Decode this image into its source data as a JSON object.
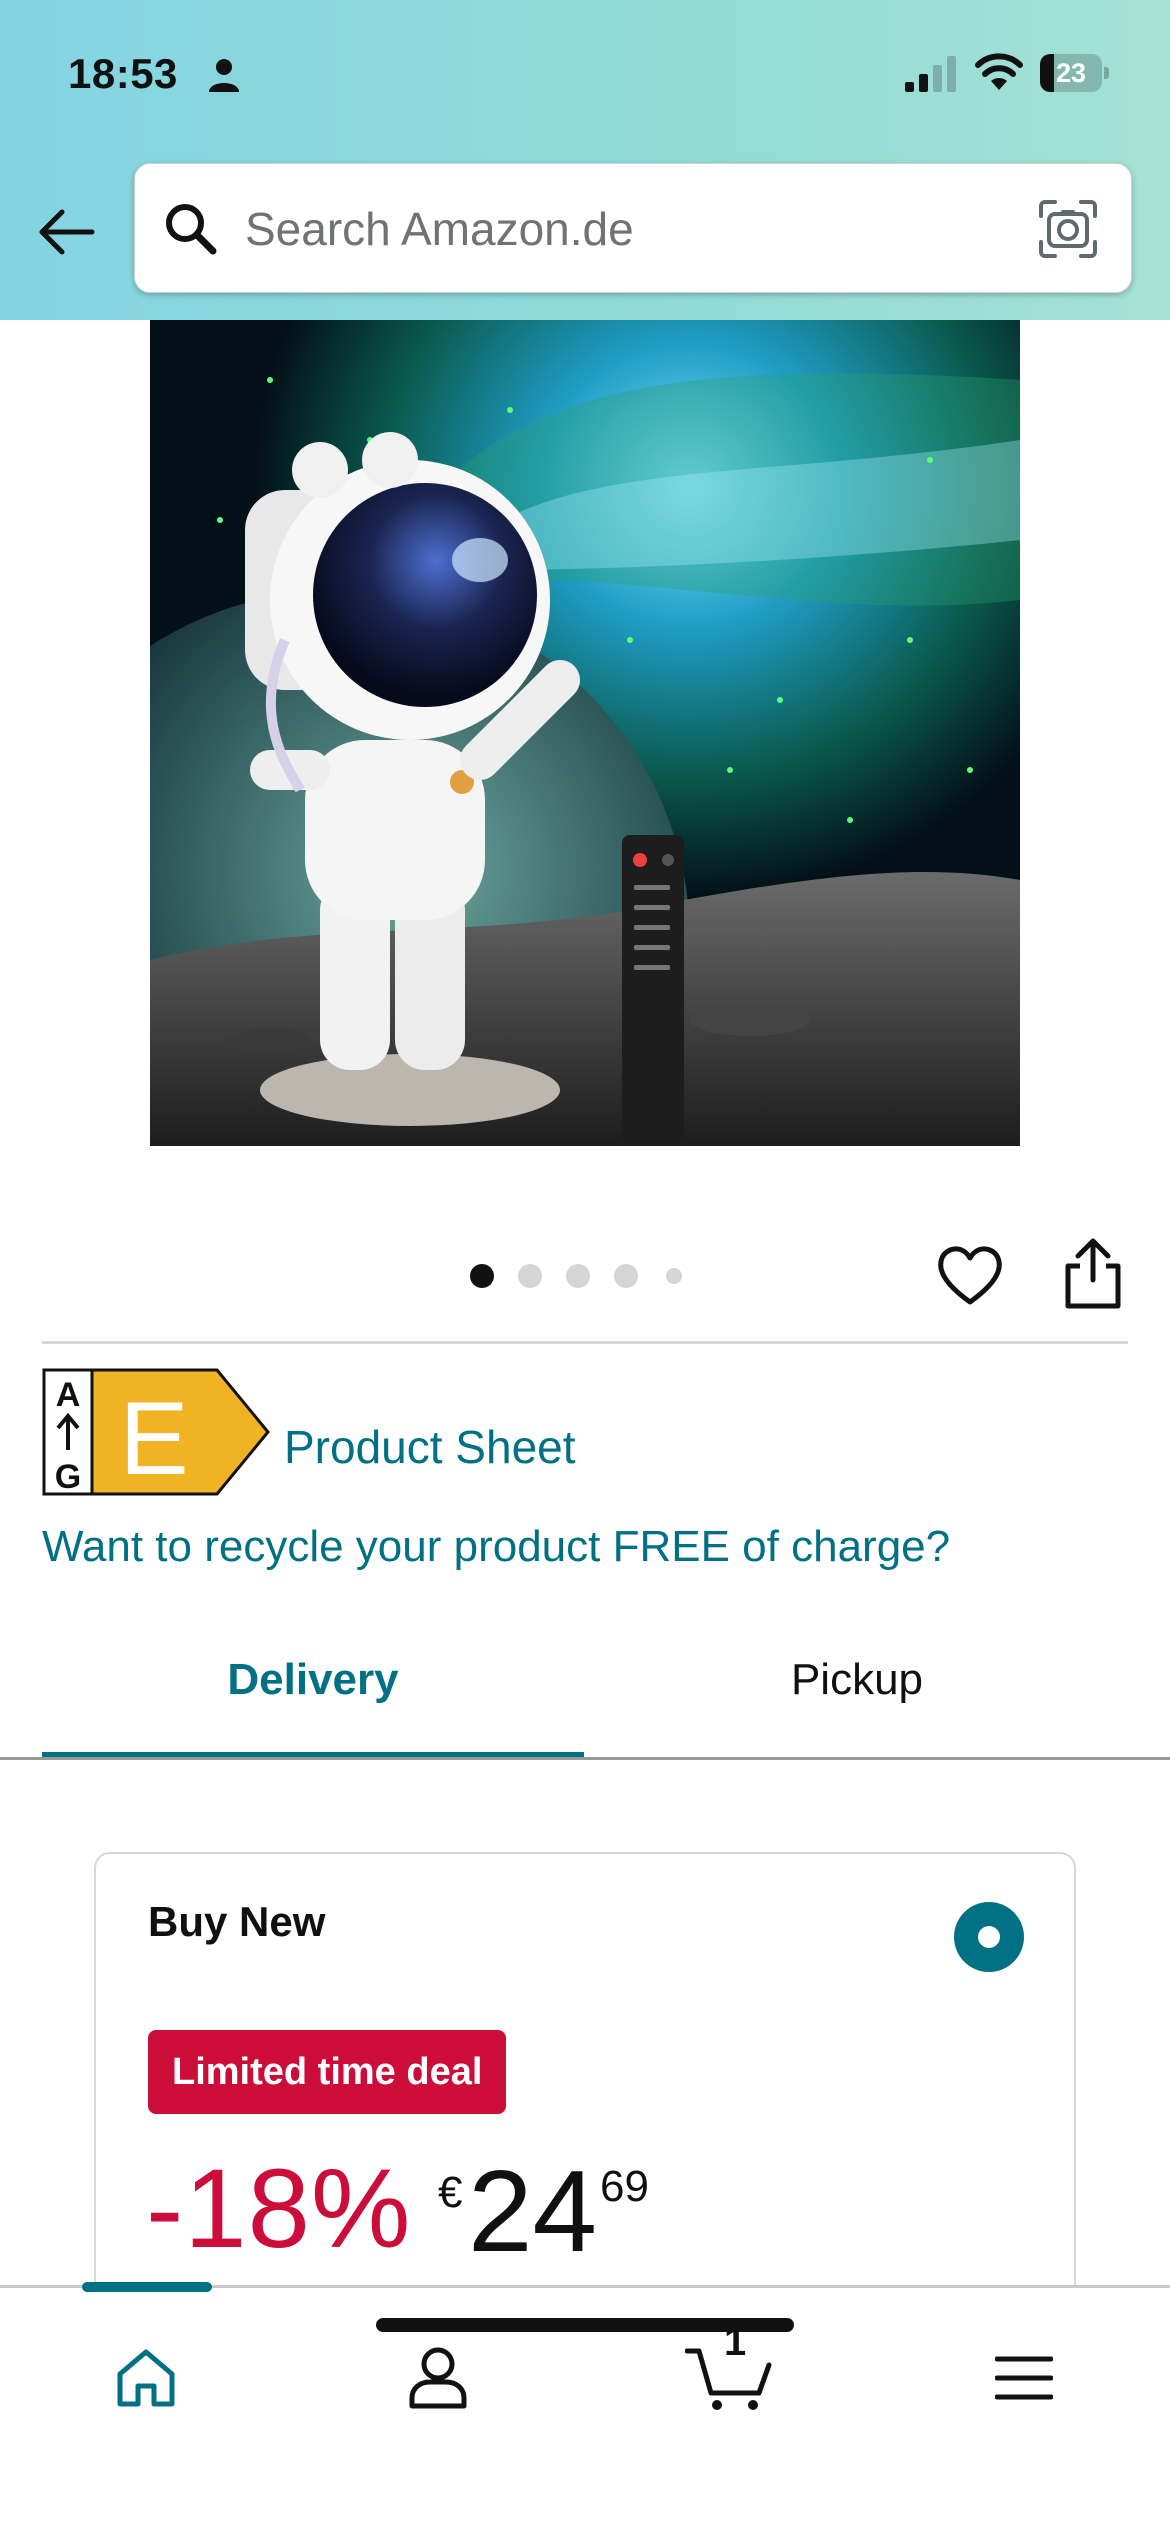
{
  "status_bar": {
    "time": "18:53",
    "battery_level": "23",
    "battery_fraction": 0.23,
    "icons": [
      "person-icon",
      "signal-icon",
      "wifi-icon",
      "battery-icon"
    ]
  },
  "search": {
    "placeholder": "Search Amazon.de",
    "value": "",
    "icons": [
      "back-arrow-icon",
      "search-icon",
      "camera-icon"
    ]
  },
  "product": {
    "image_alt": "Astronaut star projector with remote",
    "carousel_total": 5,
    "carousel_active": 1,
    "energy_label": {
      "scale_top": "A",
      "scale_bottom": "G",
      "class": "E",
      "color": "#f0b323"
    },
    "product_sheet_link": "Product Sheet",
    "recycle_link": "Want to recycle your product FREE of charge?"
  },
  "tabs": [
    {
      "label": "Delivery",
      "active": true
    },
    {
      "label": "Pickup",
      "active": false
    }
  ],
  "buy_box": {
    "title": "Buy New",
    "selected": true,
    "deal_badge": "Limited time deal",
    "discount": "-18%",
    "price_currency": "€",
    "price_whole": "24",
    "price_fraction": "69"
  },
  "bottom_nav": {
    "items": [
      "home-icon",
      "account-icon",
      "cart-icon",
      "menu-icon"
    ],
    "active": "home",
    "cart_count": "1"
  },
  "colors": {
    "accent": "#007185",
    "deal_red": "#cc0c39",
    "header_gradient_start": "#85d4e3",
    "header_gradient_end": "#a5e2d5"
  }
}
